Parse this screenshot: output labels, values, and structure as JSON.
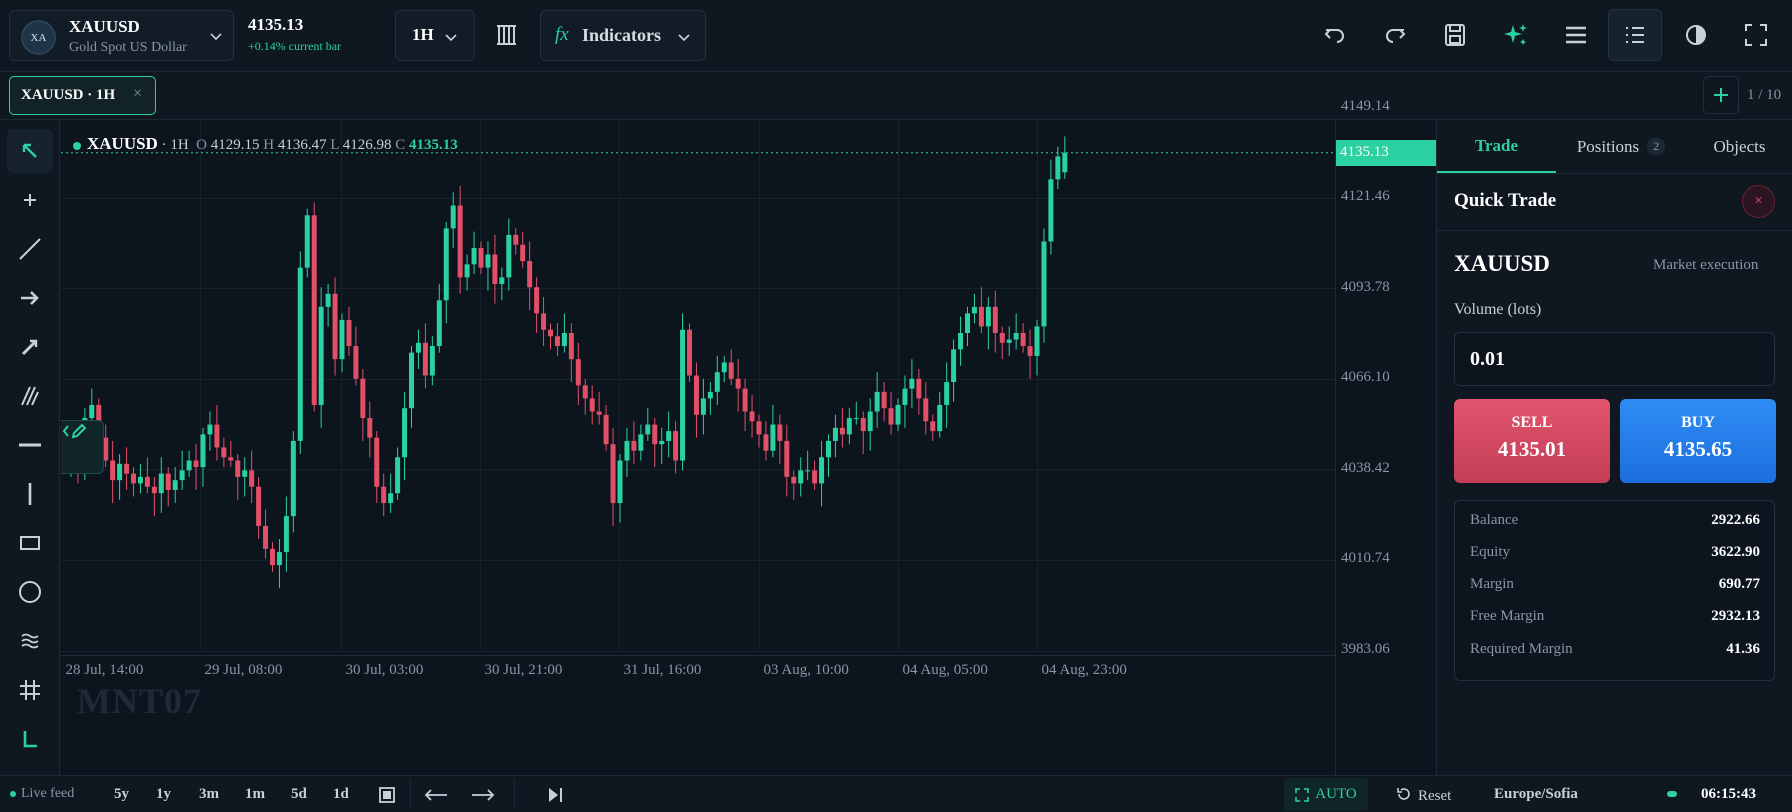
{
  "symbol": {
    "avatar": "XA",
    "name": "XAUUSD",
    "description": "Gold Spot US Dollar",
    "price": "4135.13",
    "change": "+0.14% current bar"
  },
  "toolbar": {
    "timeframe": "1H",
    "indicators_fx": "fx",
    "indicators_label": "Indicators",
    "icons": [
      "undo-icon",
      "redo-icon",
      "save-icon",
      "sparkle-icon",
      "menu-icon",
      "list-icon",
      "theme-icon",
      "fullscreen-icon"
    ]
  },
  "tabs": {
    "active_label": "XAUUSD · 1H",
    "close": "×",
    "count": "1 / 10"
  },
  "left_tools": [
    "cursor-icon",
    "crosshair-icon",
    "trend-line-icon",
    "arrow-icon",
    "ray-icon",
    "parallel-channel-icon",
    "horizontal-line-icon",
    "vertical-line-icon",
    "rectangle-icon",
    "circle-icon",
    "fib-icon",
    "grid-icon",
    "measure-icon"
  ],
  "legend": {
    "symbol": "XAUUSD",
    "timeframe": "· 1H",
    "o_label": "O",
    "o": "4129.15",
    "h_label": "H",
    "h": "4136.47",
    "l_label": "L",
    "l": "4126.98",
    "c_label": "C",
    "c": "4135.13"
  },
  "watermark": "MNT07",
  "chart_data": {
    "type": "candlestick",
    "ylim": [
      3983.06,
      4145.14
    ],
    "y_ticks": [
      "4149.14",
      "4121.46",
      "4093.78",
      "4066.10",
      "4038.42",
      "4010.74",
      "3983.06"
    ],
    "x_ticks": [
      "28 Jul, 14:00",
      "29 Jul, 08:00",
      "30 Jul, 03:00",
      "30 Jul, 21:00",
      "31 Jul, 16:00",
      "03 Aug, 10:00",
      "04 Aug, 05:00",
      "04 Aug, 23:00"
    ],
    "last_price": "4135.13",
    "up_color": "#2bd1a0",
    "down_color": "#e25068",
    "closes": [
      4043,
      4045,
      4040,
      4054,
      4058,
      4048,
      4041,
      4035,
      4040,
      4037,
      4034,
      4036,
      4033,
      4031,
      4037,
      4032,
      4035,
      4038,
      4041,
      4039,
      4049,
      4052,
      4045,
      4042,
      4041,
      4036,
      4038,
      4033,
      4021,
      4014,
      4009,
      4013,
      4024,
      4047,
      4100,
      4116,
      4058,
      4088,
      4092,
      4072,
      4084,
      4076,
      4066,
      4054,
      4048,
      4033,
      4028,
      4031,
      4042,
      4057,
      4074,
      4077,
      4067,
      4076,
      4090,
      4112,
      4119,
      4097,
      4101,
      4106,
      4100,
      4104,
      4095,
      4097,
      4110,
      4107,
      4102,
      4094,
      4086,
      4081,
      4079,
      4076,
      4080,
      4072,
      4064,
      4060,
      4056,
      4055,
      4046,
      4028,
      4041,
      4047,
      4044,
      4049,
      4052,
      4046,
      4047,
      4050,
      4041,
      4081,
      4067,
      4055,
      4060,
      4062,
      4068,
      4071,
      4066,
      4063,
      4056,
      4053,
      4049,
      4044,
      4052,
      4047,
      4036,
      4034,
      4038,
      4038,
      4034,
      4042,
      4047,
      4051,
      4049,
      4054,
      4054,
      4050,
      4056,
      4062,
      4057,
      4052,
      4058,
      4063,
      4066,
      4060,
      4053,
      4050,
      4058,
      4065,
      4075,
      4080,
      4086,
      4088,
      4082,
      4088,
      4080,
      4077,
      4078,
      4080,
      4076,
      4073,
      4082,
      4108,
      4127,
      4134,
      4135.13
    ]
  },
  "panel": {
    "tabs": [
      {
        "label": "Trade"
      },
      {
        "label": "Positions",
        "badge": "2"
      },
      {
        "label": "Objects"
      }
    ],
    "title": "Quick Trade",
    "close": "×",
    "symbol": "XAUUSD",
    "execution": "Market execution",
    "volume_label": "Volume (lots)",
    "volume_value": "0.01",
    "sell_label": "SELL",
    "sell_price": "4135.01",
    "buy_label": "BUY",
    "buy_price": "4135.65",
    "account": [
      {
        "k": "Balance",
        "v": "2922.66"
      },
      {
        "k": "Equity",
        "v": "3622.90"
      },
      {
        "k": "Margin",
        "v": "690.77"
      },
      {
        "k": "Free Margin",
        "v": "2932.13"
      },
      {
        "k": "Required Margin",
        "v": "41.36"
      }
    ]
  },
  "bottom": {
    "live": "Live feed",
    "ranges": [
      "5y",
      "1y",
      "3m",
      "1m",
      "5d",
      "1d"
    ],
    "auto": "AUTO",
    "reset": "Reset",
    "timezone": "Europe/Sofia",
    "clock": "06:15:43"
  },
  "colors": {
    "accent": "#2bd1a0",
    "sell": "#e2546d",
    "buy": "#2f8cf5",
    "bg": "#0e1620"
  }
}
